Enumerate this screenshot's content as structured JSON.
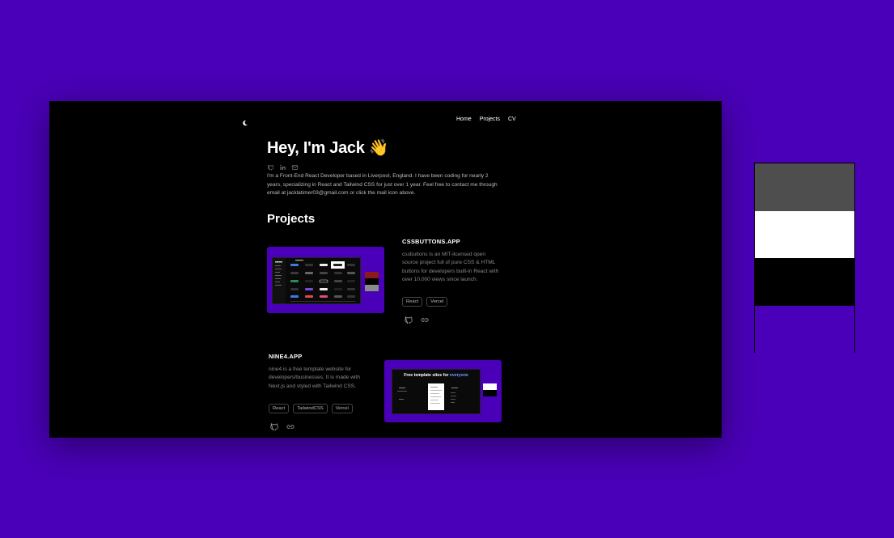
{
  "nav": {
    "items": [
      "Home",
      "Projects",
      "CV"
    ],
    "theme_icon": "moon-icon"
  },
  "hero": {
    "title": "Hey, I'm Jack 👋",
    "social_icons": [
      "github-icon",
      "linkedin-icon",
      "mail-icon"
    ],
    "bio": "I'm a Front-End React Developer based in Liverpool, England. I have been coding for nearly 2 years, specializing in React and Tailwind CSS for just over 1 year. Feel free to contact me through email at jacklatimer03@gmail.com or click the mail icon above."
  },
  "projects": {
    "heading": "Projects",
    "items": [
      {
        "title": "CSSBUTTONS.APP",
        "description": "cssbuttons is an MIT-licensed open source project full of pure CSS & HTML buttons for developers built-in React with over 10,000 views since launch.",
        "tags": [
          "React",
          "Vercel"
        ],
        "link_icons": [
          "github-icon",
          "link-icon"
        ]
      },
      {
        "title": "NINE4.APP",
        "description": "nine4 is a free template website for developers/businesses. It is made with Next.js and styled with Tailwind CSS.",
        "tags": [
          "React",
          "TailwindCSS",
          "Vercel"
        ],
        "link_icons": [
          "github-icon",
          "link-icon"
        ],
        "preview_heading": "Free template sites for",
        "preview_heading_accent": "everyone"
      }
    ]
  },
  "palette": {
    "colors": [
      "#4e4e4e",
      "#ffffff",
      "#000000",
      "#4a00b8"
    ]
  }
}
